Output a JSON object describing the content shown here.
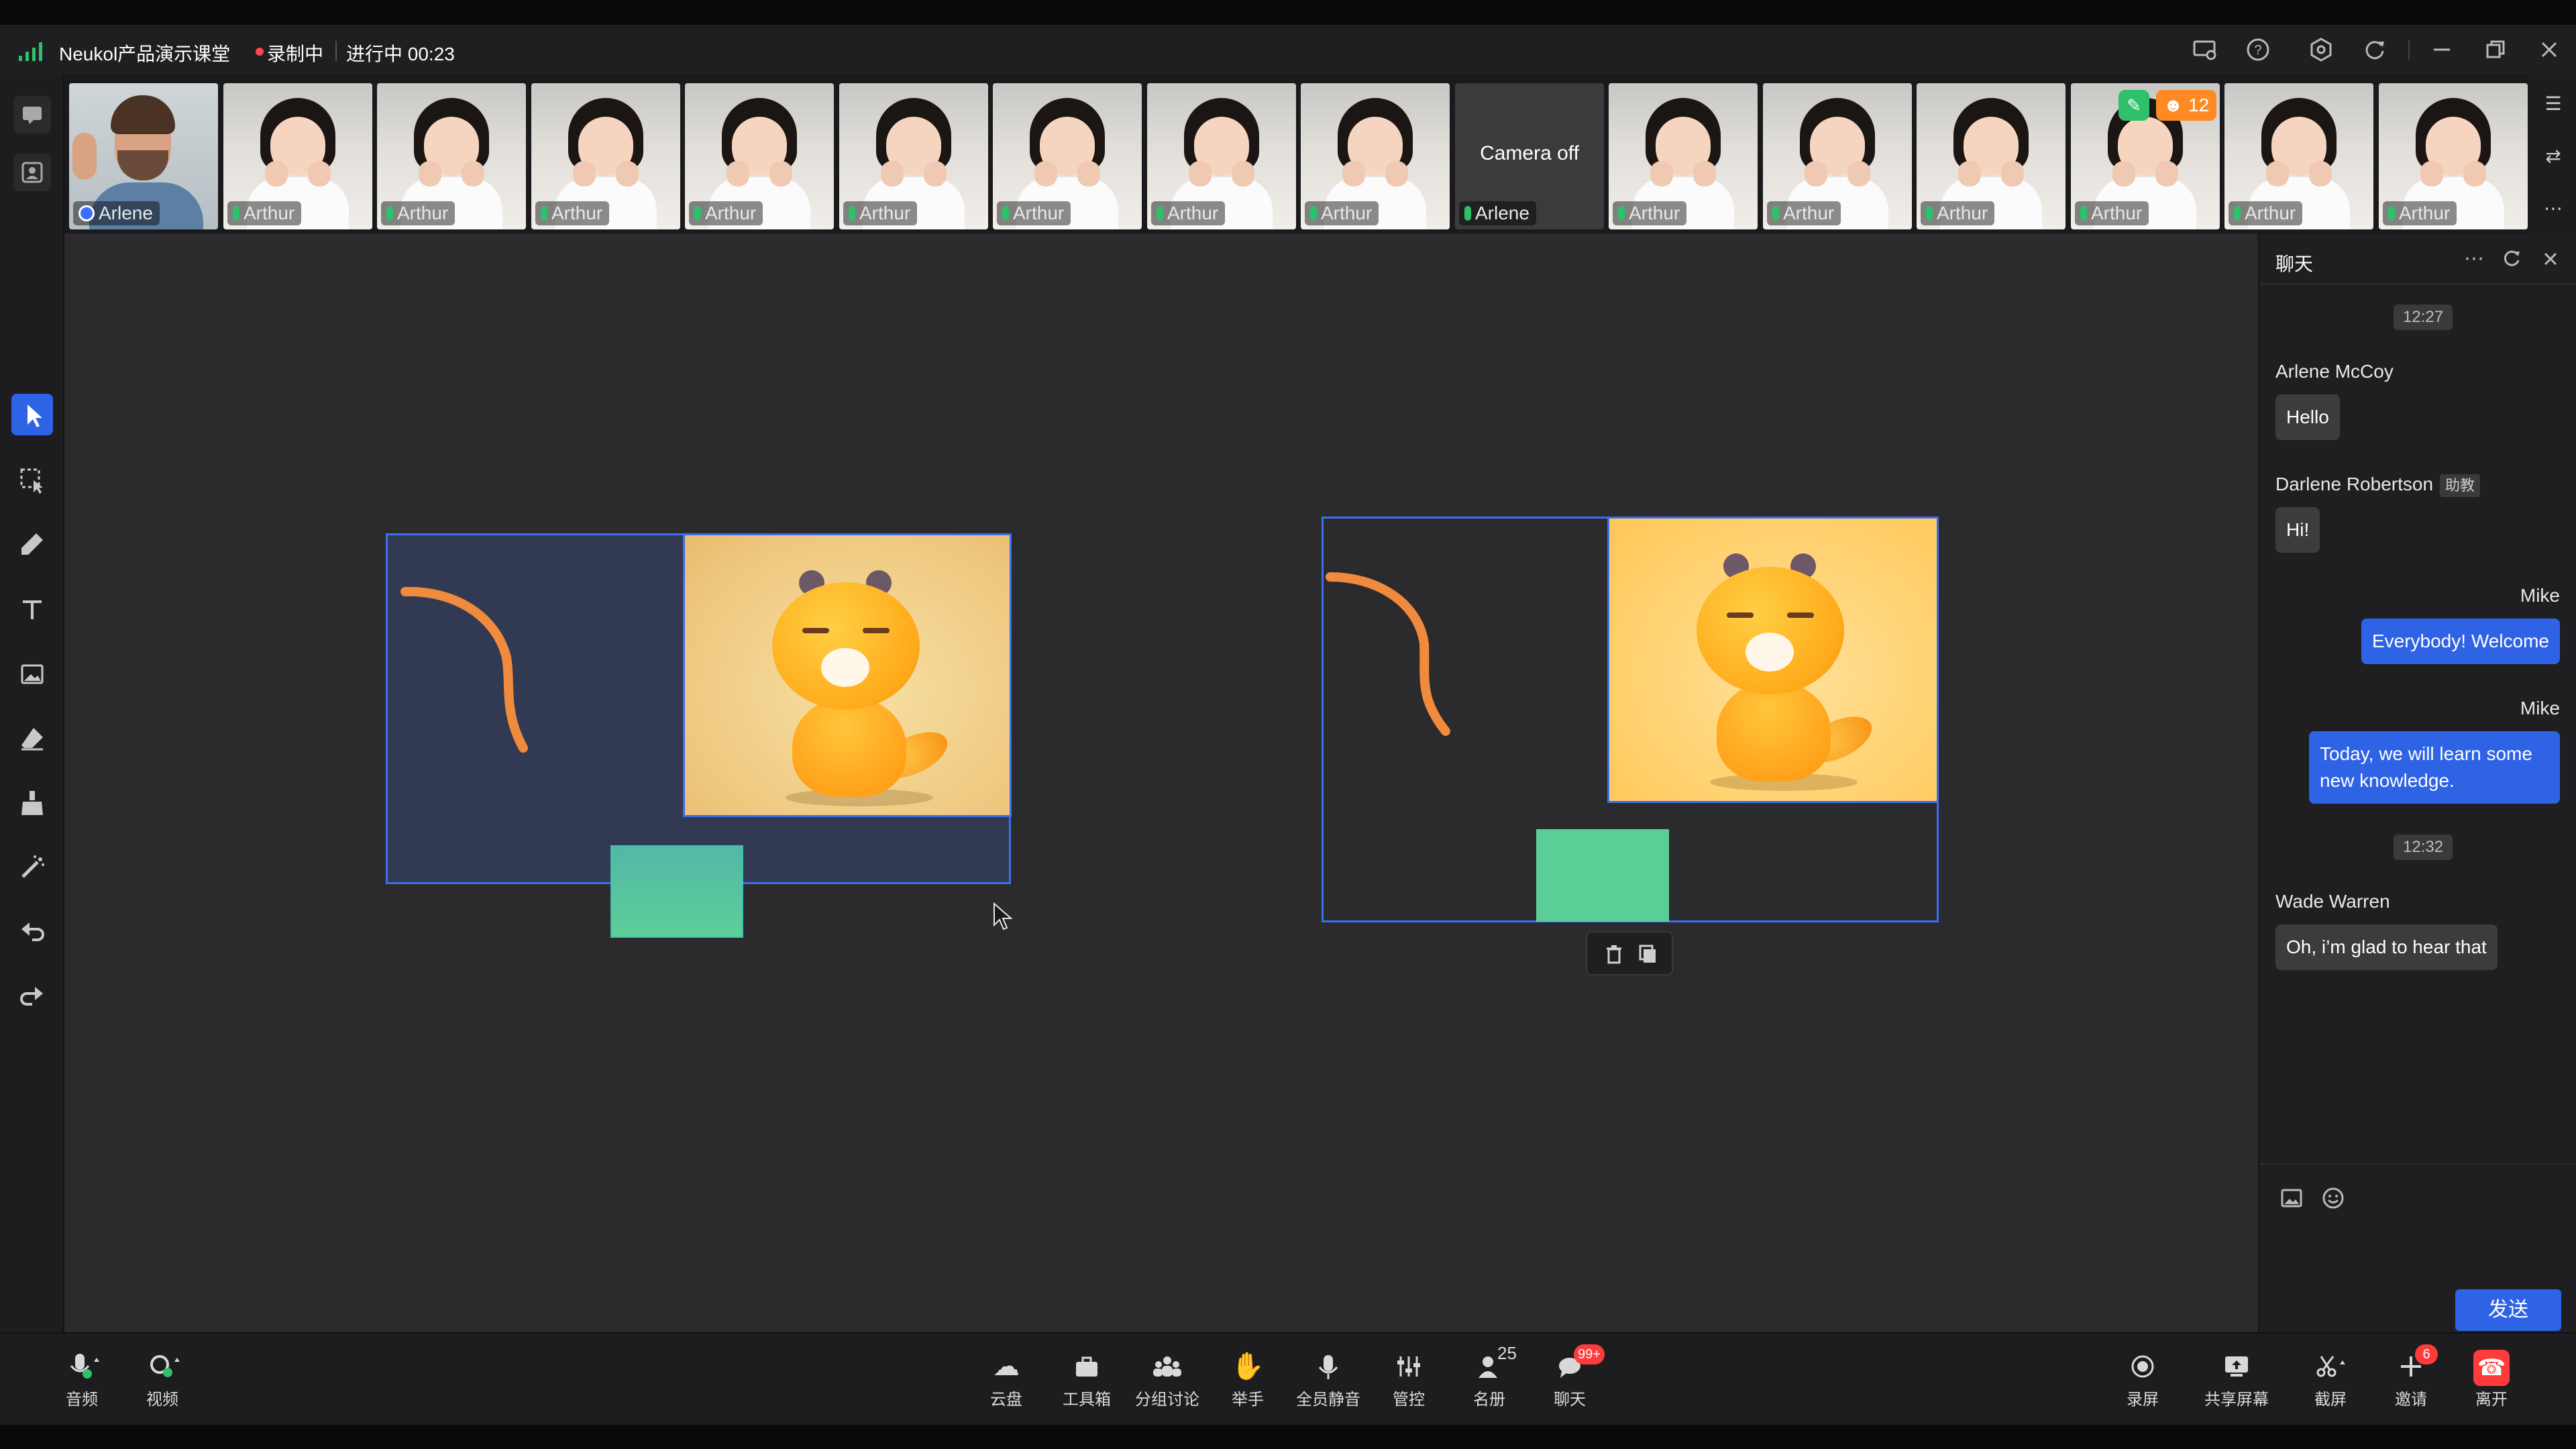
{
  "window": {
    "title": "Neukol产品演示课堂",
    "recording_label": "录制中",
    "status_label": "进行中 00:23",
    "icons": [
      "screen-cast-icon",
      "help-icon",
      "settings-icon",
      "refresh-icon",
      "minimize-icon",
      "restore-icon",
      "close-icon"
    ]
  },
  "participants": [
    {
      "name": "Arlene",
      "camera": "on",
      "type": "man"
    },
    {
      "name": "Arthur",
      "camera": "on",
      "type": "girl"
    },
    {
      "name": "Arthur",
      "camera": "on",
      "type": "girl"
    },
    {
      "name": "Arthur",
      "camera": "on",
      "type": "girl"
    },
    {
      "name": "Arthur",
      "camera": "on",
      "type": "girl"
    },
    {
      "name": "Arthur",
      "camera": "on",
      "type": "girl"
    },
    {
      "name": "Arthur",
      "camera": "on",
      "type": "girl"
    },
    {
      "name": "Arthur",
      "camera": "on",
      "type": "girl"
    },
    {
      "name": "Arthur",
      "camera": "on",
      "type": "girl"
    },
    {
      "name": "Arlene",
      "camera": "off",
      "type": "off",
      "camera_off_label": "Camera off"
    },
    {
      "name": "Arthur",
      "camera": "on",
      "type": "girl"
    },
    {
      "name": "Arthur",
      "camera": "on",
      "type": "girl"
    },
    {
      "name": "Arthur",
      "camera": "on",
      "type": "girl"
    },
    {
      "name": "Arthur",
      "camera": "on",
      "type": "girl"
    },
    {
      "name": "Arthur",
      "camera": "on",
      "type": "girl"
    },
    {
      "name": "Arthur",
      "camera": "on",
      "type": "girl"
    }
  ],
  "strip_badges": {
    "orange_count": "12"
  },
  "whiteboard_tools": [
    "select-arrow",
    "box-select",
    "pen",
    "text",
    "image",
    "eraser",
    "brush-clear",
    "laser-pointer",
    "undo",
    "redo"
  ],
  "chat": {
    "title": "聊天",
    "messages": [
      {
        "kind": "time",
        "text": "12:27"
      },
      {
        "kind": "in",
        "name": "Arlene McCoy",
        "text": "Hello"
      },
      {
        "kind": "in",
        "name": "Darlene Robertson",
        "tag": "助教",
        "text": "Hi!"
      },
      {
        "kind": "out",
        "name": "Mike",
        "text": "Everybody! Welcome"
      },
      {
        "kind": "out",
        "name": "Mike",
        "text": "Today, we will learn some new knowledge."
      },
      {
        "kind": "time",
        "text": "12:32"
      },
      {
        "kind": "in",
        "name": "Wade Warren",
        "text": "Oh, i’m glad to hear that"
      }
    ],
    "send_label": "发送"
  },
  "bottom_left": [
    {
      "label": "音频",
      "icon": "microphone-icon"
    },
    {
      "label": "视频",
      "icon": "camera-icon"
    }
  ],
  "bottom_center": [
    {
      "label": "云盘",
      "icon": "cloud-icon"
    },
    {
      "label": "工具箱",
      "icon": "toolbox-icon"
    },
    {
      "label": "分组讨论",
      "icon": "group-icon"
    },
    {
      "label": "举手",
      "icon": "raise-hand-icon"
    },
    {
      "label": "全员静音",
      "icon": "mute-all-icon"
    },
    {
      "label": "管控",
      "icon": "controls-icon"
    },
    {
      "label": "名册",
      "icon": "roster-icon",
      "sup": "25"
    },
    {
      "label": "聊天",
      "icon": "chat-icon",
      "badge": "99+"
    }
  ],
  "bottom_right": [
    {
      "label": "录屏",
      "icon": "record-icon"
    },
    {
      "label": "共享屏幕",
      "icon": "share-screen-icon"
    },
    {
      "label": "截屏",
      "icon": "screenshot-icon"
    },
    {
      "label": "邀请",
      "icon": "invite-icon",
      "badge": "6"
    },
    {
      "label": "离开",
      "icon": "leave-icon"
    }
  ],
  "colors": {
    "accent": "#2f63e6",
    "record": "#ff4747",
    "mic": "#2fc06b",
    "shape_green": "#5ccf98",
    "stroke_orange": "#f08a3c"
  }
}
